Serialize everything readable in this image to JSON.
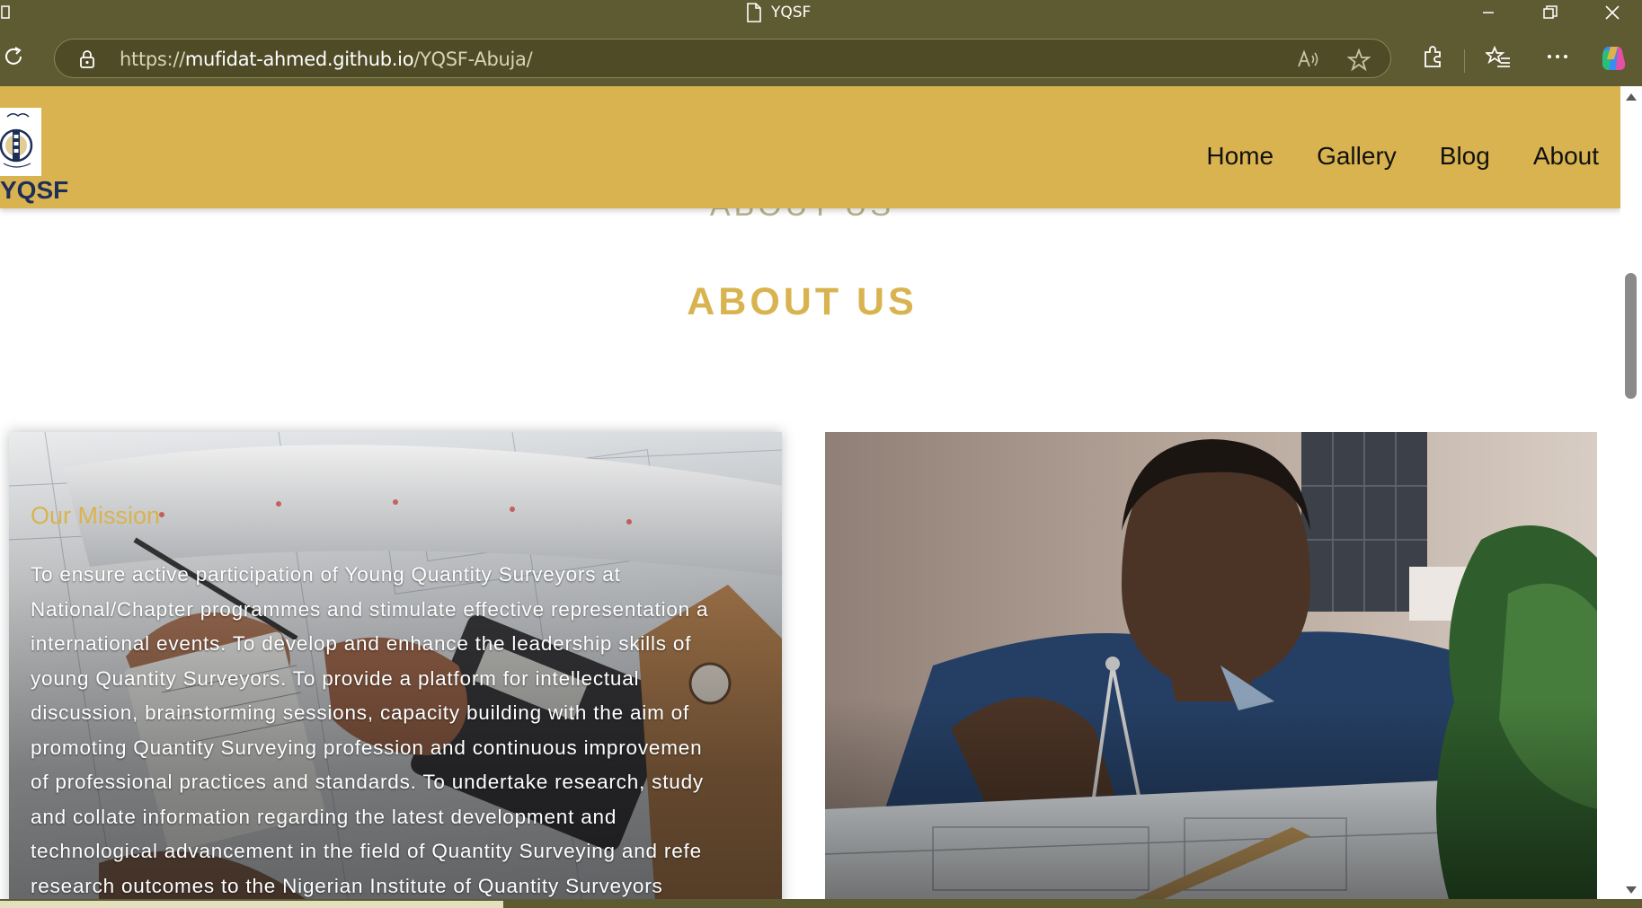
{
  "browser": {
    "tab_title": "YQSF",
    "url_prefix": "https://",
    "url_host": "mufidat-ahmed.github.io",
    "url_path": "/YQSF-Abuja/"
  },
  "site": {
    "logo_text": "YQSF",
    "nav": [
      "Home",
      "Gallery",
      "Blog",
      "About"
    ]
  },
  "page": {
    "ghost_heading": "ABOUT US",
    "heading": "ABOUT US",
    "mission_title": "Our Mission",
    "mission_lines": [
      "To ensure active participation of Young Quantity Surveyors at",
      "National/Chapter programmes and stimulate effective representation a",
      "international events. To develop and enhance the leadership skills of",
      "young Quantity Surveyors. To provide a platform for intellectual",
      "discussion, brainstorming sessions, capacity building with the aim of",
      "promoting Quantity Surveying profession and continuous improvemen",
      "of professional practices and standards. To undertake research, study",
      "and collate information regarding the latest development and",
      "technological advancement in the field of Quantity Surveying and refe",
      "research outcomes to the Nigerian Institute of Quantity Surveyors"
    ]
  },
  "colors": {
    "chrome": "#5e5a31",
    "header": "#d9b34f",
    "accent": "#d9b34f",
    "logo_text": "#1d2f59"
  }
}
